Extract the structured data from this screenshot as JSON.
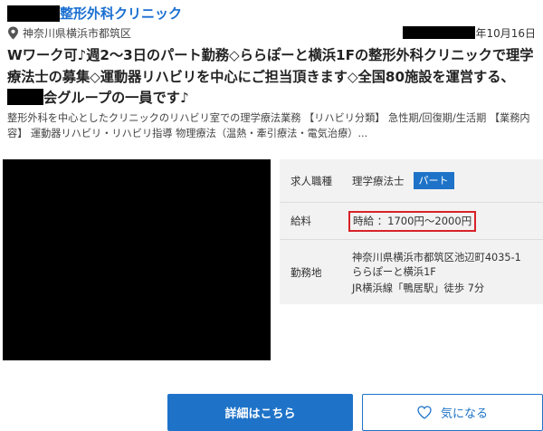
{
  "clinic": {
    "name": "整形外科クリニック"
  },
  "meta": {
    "location": "神奈川県横浜市都筑区",
    "date_suffix": "年10月16日"
  },
  "job": {
    "title_part1": "Wワーク可♪週2～3日のパート勤務◇ららぽーと横浜1Fの整形外科クリニックで理学療法士の募集◇運動器リハビリを中心にご担当頂きます◇全国80施設を運営する、",
    "title_part2": "会グループの一員です♪",
    "description": "整形外科を中心としたクリニックのリハビリ室での理学療法業務 【リハビリ分類】 急性期/回復期/生活期 【業務内容】 運動器リハビリ・リハビリ指導 物理療法（温熱・牽引療法・電気治療）..."
  },
  "info": {
    "type_label": "求人職種",
    "type_value": "理学療法士",
    "type_badge": "パート",
    "salary_label": "給料",
    "salary_value": "時給 ：1700円～2000円",
    "location_label": "勤務地",
    "address_line1": "神奈川県横浜市都筑区池辺町4035-1　ららぽーと横浜1F",
    "address_line2": "JR横浜線「鴨居駅」徒歩 7分"
  },
  "buttons": {
    "detail_label": "詳細はこちら",
    "favorite_label": "気になる"
  },
  "icons": {
    "location": "map-pin-icon",
    "favorite": "heart-icon"
  },
  "colors": {
    "accent": "#1e73c8",
    "highlight_border": "#d8222a",
    "table_bg": "#f2f2f2"
  }
}
